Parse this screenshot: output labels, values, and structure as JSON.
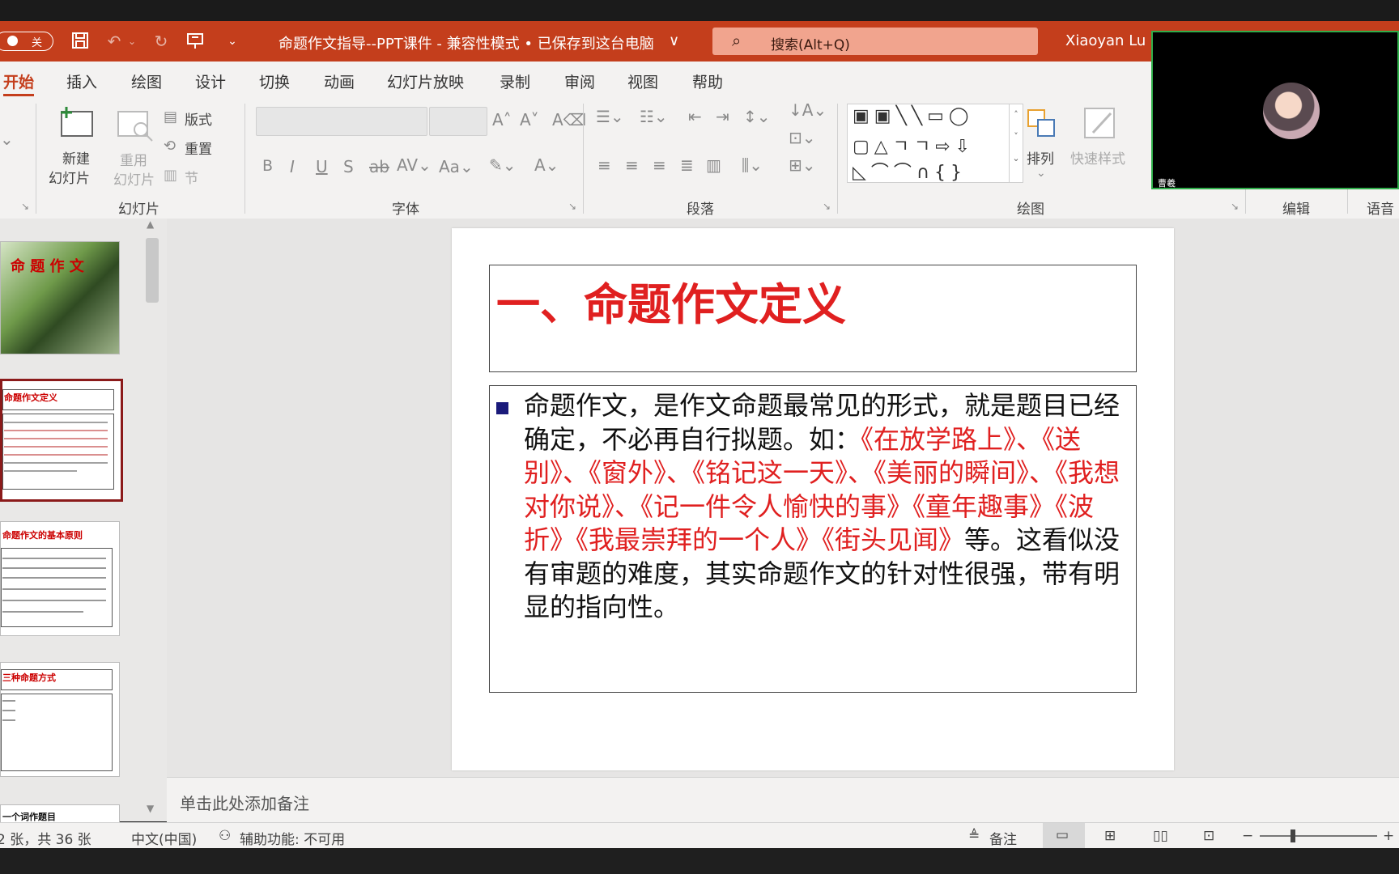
{
  "titlebar": {
    "autosave_label": "关",
    "document_title": "命题作文指导--PPT课件  -  兼容性模式 • 已保存到这台电脑",
    "title_chevron": "∨",
    "search_placeholder": "搜索(Alt+Q)",
    "user_name": "Xiaoyan Lu"
  },
  "tabs": [
    "开始",
    "插入",
    "绘图",
    "设计",
    "切换",
    "动画",
    "幻灯片放映",
    "录制",
    "审阅",
    "视图",
    "帮助"
  ],
  "ribbon": {
    "new_slide_line1": "新建",
    "new_slide_line2": "幻灯片",
    "reuse_line1": "重用",
    "reuse_line2": "幻灯片",
    "layout": "版式",
    "reset": "重置",
    "section": "节",
    "arrange": "排列",
    "quick_styles": "快速样式",
    "groups": {
      "slides": "幻灯片",
      "font": "字体",
      "paragraph": "段落",
      "drawing": "绘图",
      "editing": "编辑",
      "voice": "语音"
    }
  },
  "thumbnails": {
    "t1_title": "命 题 作 文",
    "t2_title": "命题作文定义",
    "t3_title": "命题作文的基本原则",
    "t4_title": "三种命题方式",
    "t5_title": "一个词作题目"
  },
  "slide": {
    "title": "一、命题作文定义",
    "body_black_1": "命题作文，是作文命题最常见的形式，就是题目已经确定，不必再自行拟题。如：",
    "body_red": "《在放学路上》、《送别》、《窗外》、《铭记这一天》、《美丽的瞬间》、《我想对你说》、《记一件令人愉快的事》《童年趣事》《波折》《我最崇拜的一个人》《街头见闻》",
    "body_black_2": "等。这看似没有审题的难度，其实命题作文的针对性很强，带有明显的指向性。"
  },
  "notes_placeholder": "单击此处添加备注",
  "statusbar": {
    "slide_count": "2 张，共 36 张",
    "language": "中文(中国)",
    "accessibility": "辅助功能: 不可用",
    "notes_button": "备注"
  },
  "video": {
    "participant_name": "曹羲"
  },
  "colors": {
    "accent": "#c43e1c",
    "title_red": "#e02020",
    "bullet_navy": "#1a1a7a"
  }
}
